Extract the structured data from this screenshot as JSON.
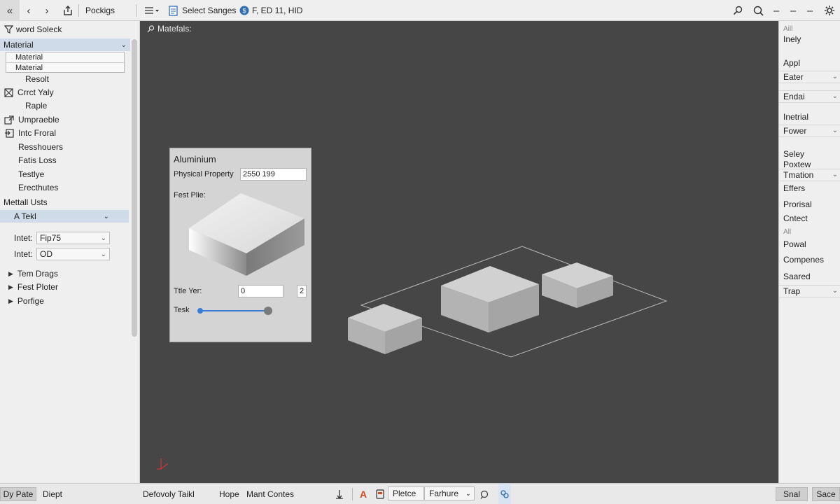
{
  "toolbar": {
    "tab_title": "Pockigs",
    "select_label": "Select Sanges",
    "status_text": "F, ED 11, HID",
    "icons": [
      "double-left-chevron-icon",
      "back-chevron-icon",
      "forward-chevron-icon",
      "share-upload-icon",
      "menu-lines-icon",
      "document-icon",
      "info-badge-icon",
      "key-search-icon",
      "zoom-search-icon",
      "minimize-icon",
      "restore-icon",
      "window-dash-icon",
      "settings-gear-icon"
    ]
  },
  "left_panel": {
    "header": "word Soleck",
    "section_title": "Material",
    "material_items": [
      "Material",
      "Material"
    ],
    "items": [
      "Resolt",
      "Crrct Yaly",
      "Raple",
      "Umpraeble",
      "Intc Froral",
      "Resshouers",
      "Fatis Loss",
      "Testlye",
      "Erecthutes"
    ],
    "metal_units_title": "Mettall Usts",
    "metal_selected": "A Tekl",
    "inputs": [
      {
        "label": "Intet:",
        "value": "Fip75"
      },
      {
        "label": "Intet:",
        "value": "OD"
      }
    ],
    "tree_items": [
      "Tem Drags",
      "Fest Ploter",
      "Porfige"
    ]
  },
  "viewport": {
    "label": "Matefals:",
    "card": {
      "title": "Aluminium",
      "property_label": "Physical Property",
      "property_value": "2550 199",
      "preview_label": "Fest Plie:",
      "title_year_label": "Ttle Yer:",
      "title_year_value": "0",
      "title_year_badge": "2",
      "task_label": "Tesk",
      "task_slider_fraction": 0.98
    },
    "accent_color": "#3a7bd5"
  },
  "right_panel": {
    "items": [
      {
        "text": "Aill",
        "kind": "small"
      },
      {
        "text": "Inely",
        "kind": "plain"
      },
      {
        "text": "Appl",
        "kind": "plain"
      },
      {
        "text": "Eater",
        "kind": "box"
      },
      {
        "text": "Endai",
        "kind": "box"
      },
      {
        "text": "Inetrial",
        "kind": "plain"
      },
      {
        "text": "Fower",
        "kind": "box"
      },
      {
        "text": "Seley",
        "kind": "plain"
      },
      {
        "text": "Poxtew",
        "kind": "plain"
      },
      {
        "text": "Tmation",
        "kind": "box"
      },
      {
        "text": "Effers",
        "kind": "plain"
      },
      {
        "text": "Prorisal",
        "kind": "plain"
      },
      {
        "text": "Cntect",
        "kind": "plain"
      },
      {
        "text": "All",
        "kind": "small"
      },
      {
        "text": "Powal",
        "kind": "plain"
      },
      {
        "text": "Compenes",
        "kind": "plain"
      },
      {
        "text": "Saared",
        "kind": "plain"
      },
      {
        "text": "Trap",
        "kind": "box"
      }
    ]
  },
  "bottom_bar": {
    "tab1": "Dy Pate",
    "tab2": "Diept",
    "text1": "Defovoly Taikl",
    "text2": "Hope",
    "text3": "Mant Contes",
    "field1": "Pletce",
    "select1": "Farhure",
    "button1": "Snal",
    "button2": "Sace"
  }
}
